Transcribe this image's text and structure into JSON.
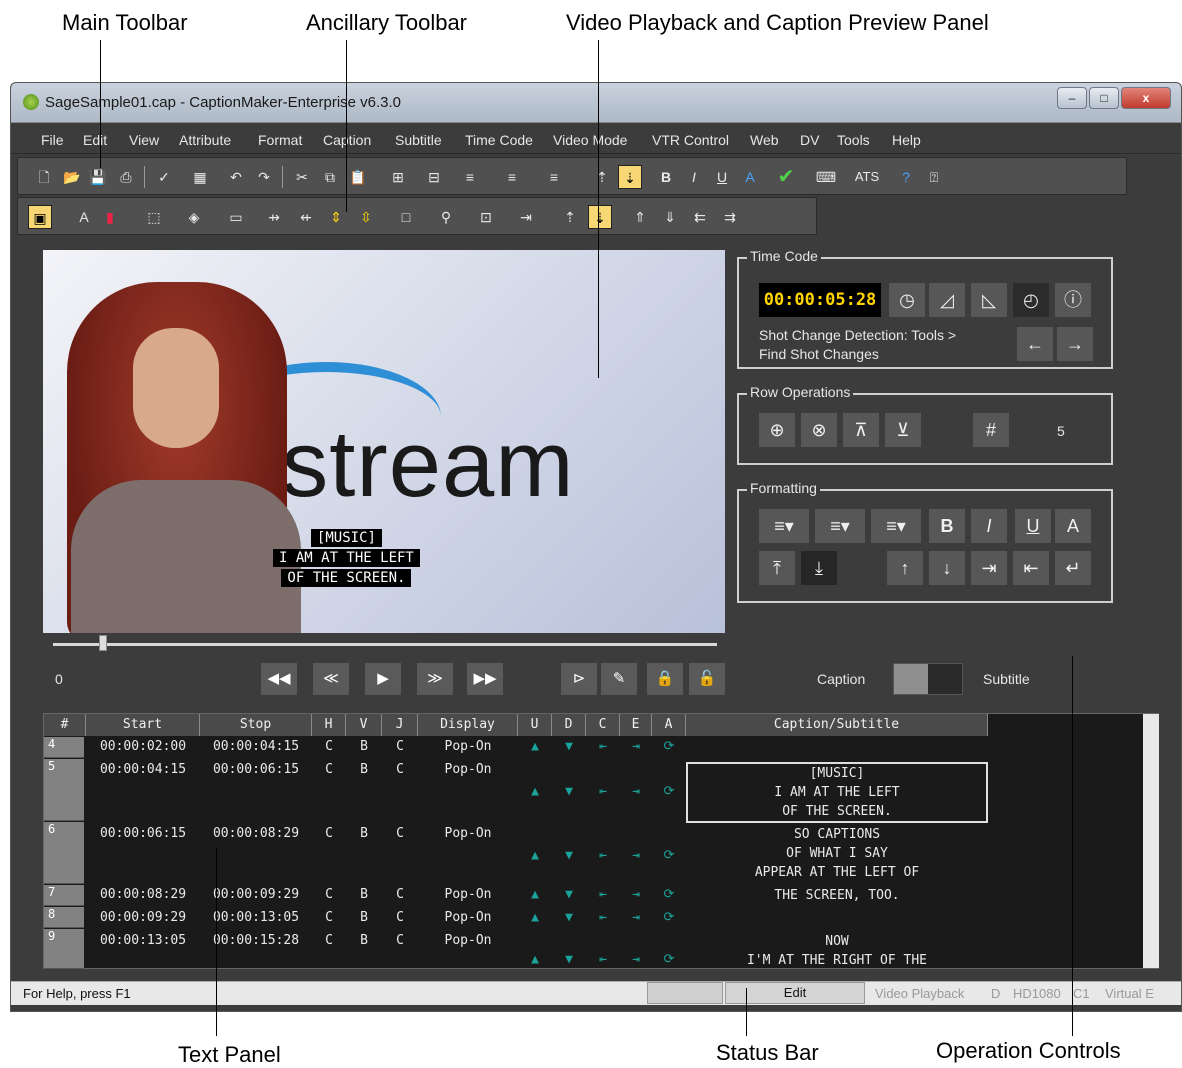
{
  "callouts": {
    "main_toolbar": "Main Toolbar",
    "ancillary_toolbar": "Ancillary Toolbar",
    "video_panel": "Video Playback and Caption Preview Panel",
    "text_panel": "Text Panel",
    "status_bar": "Status Bar",
    "operation_controls": "Operation Controls"
  },
  "window": {
    "title": "SageSample01.cap - CaptionMaker-Enterprise v6.3.0",
    "minimize": "–",
    "maximize": "□",
    "close": "x"
  },
  "menu": [
    "File",
    "Edit",
    "View",
    "Attribute",
    "Format",
    "Caption",
    "Subtitle",
    "Time Code",
    "Video Mode",
    "VTR Control",
    "Web",
    "DV",
    "Tools",
    "Help"
  ],
  "toolbar": {
    "ats_label": "ATS"
  },
  "video": {
    "logo_text": "estream",
    "caption_lines": [
      "[MUSIC]",
      "I AM AT THE LEFT",
      "OF THE SCREEN."
    ]
  },
  "playback": {
    "position_label": "0"
  },
  "time_code": {
    "group_title": "Time Code",
    "value": "00:00:05:28",
    "shot_change_text_1": "Shot Change Detection: Tools >",
    "shot_change_text_2": "Find Shot Changes"
  },
  "row_operations": {
    "group_title": "Row Operations",
    "hash_label": "#",
    "row_count": "5"
  },
  "formatting": {
    "group_title": "Formatting",
    "bold": "B",
    "italic": "I",
    "underline": "U",
    "color": "A"
  },
  "mode_toggle": {
    "left": "Caption",
    "right": "Subtitle"
  },
  "grid": {
    "headers": [
      "#",
      "Start",
      "Stop",
      "H",
      "V",
      "J",
      "Display",
      "U",
      "D",
      "C",
      "E",
      "A",
      "Caption/Subtitle"
    ],
    "rows": [
      {
        "num": "4",
        "start": "00:00:02:00",
        "stop": "00:00:04:15",
        "h": "C",
        "v": "B",
        "j": "C",
        "display": "Pop-On",
        "caption": []
      },
      {
        "num": "5",
        "start": "00:00:04:15",
        "stop": "00:00:06:15",
        "h": "C",
        "v": "B",
        "j": "C",
        "display": "Pop-On",
        "caption": [
          "[MUSIC]",
          "I AM AT THE LEFT",
          "OF THE SCREEN."
        ]
      },
      {
        "num": "6",
        "start": "00:00:06:15",
        "stop": "00:00:08:29",
        "h": "C",
        "v": "B",
        "j": "C",
        "display": "Pop-On",
        "caption": [
          "SO CAPTIONS",
          "OF WHAT I SAY",
          "APPEAR AT THE LEFT OF"
        ]
      },
      {
        "num": "7",
        "start": "00:00:08:29",
        "stop": "00:00:09:29",
        "h": "C",
        "v": "B",
        "j": "C",
        "display": "Pop-On",
        "caption": [
          "THE SCREEN, TOO."
        ]
      },
      {
        "num": "8",
        "start": "00:00:09:29",
        "stop": "00:00:13:05",
        "h": "C",
        "v": "B",
        "j": "C",
        "display": "Pop-On",
        "caption": []
      },
      {
        "num": "9",
        "start": "00:00:13:05",
        "stop": "00:00:15:28",
        "h": "C",
        "v": "B",
        "j": "C",
        "display": "Pop-On",
        "caption": [
          "NOW",
          "I'M AT THE RIGHT OF THE"
        ]
      }
    ]
  },
  "status": {
    "help": "For Help, press F1",
    "mode": "Edit",
    "panel": "Video Playback",
    "d": "D",
    "format": "HD1080",
    "channel": "C1",
    "virtual": "Virtual E"
  }
}
